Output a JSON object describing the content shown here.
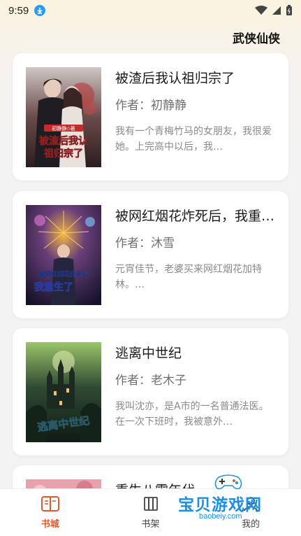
{
  "status_bar": {
    "time": "9:59"
  },
  "header": {
    "title": "武侠仙侠"
  },
  "books": [
    {
      "title": "被渣后我认祖归宗了",
      "author": "作者：初静静",
      "description": "我有一个青梅竹马的女朋友，我很爱她。上完高中以后，我…",
      "cover_text": "被渣后我认祖归宗了",
      "cover_author": "初静静◇著"
    },
    {
      "title": "被网红烟花炸死后，我重生了",
      "author": "作者：沐雪",
      "description": "元宵佳节，老婆买来网红烟花加特林。…",
      "cover_text": "被网红烟花炸死后",
      "cover_text2": "我重生了"
    },
    {
      "title": "逃离中世纪",
      "author": "作者：老木子",
      "description": "我叫沈亦，是A市的一名普通法医。在一次下班时，我被意外…",
      "cover_text": "逃离中世纪"
    },
    {
      "title": "重生八零年代"
    }
  ],
  "tabs": [
    {
      "label": "书城",
      "icon": "book-open-icon",
      "active": true
    },
    {
      "label": "书架",
      "icon": "bookshelf-icon",
      "active": false
    },
    {
      "label": "我的",
      "icon": "user-icon",
      "active": false
    }
  ],
  "watermark": {
    "text": "宝贝游戏网",
    "url": "baobeiy.com"
  },
  "colors": {
    "accent": "#e05a2b",
    "card_bg": "#ffffff",
    "page_bg": "#f3f3f3"
  }
}
